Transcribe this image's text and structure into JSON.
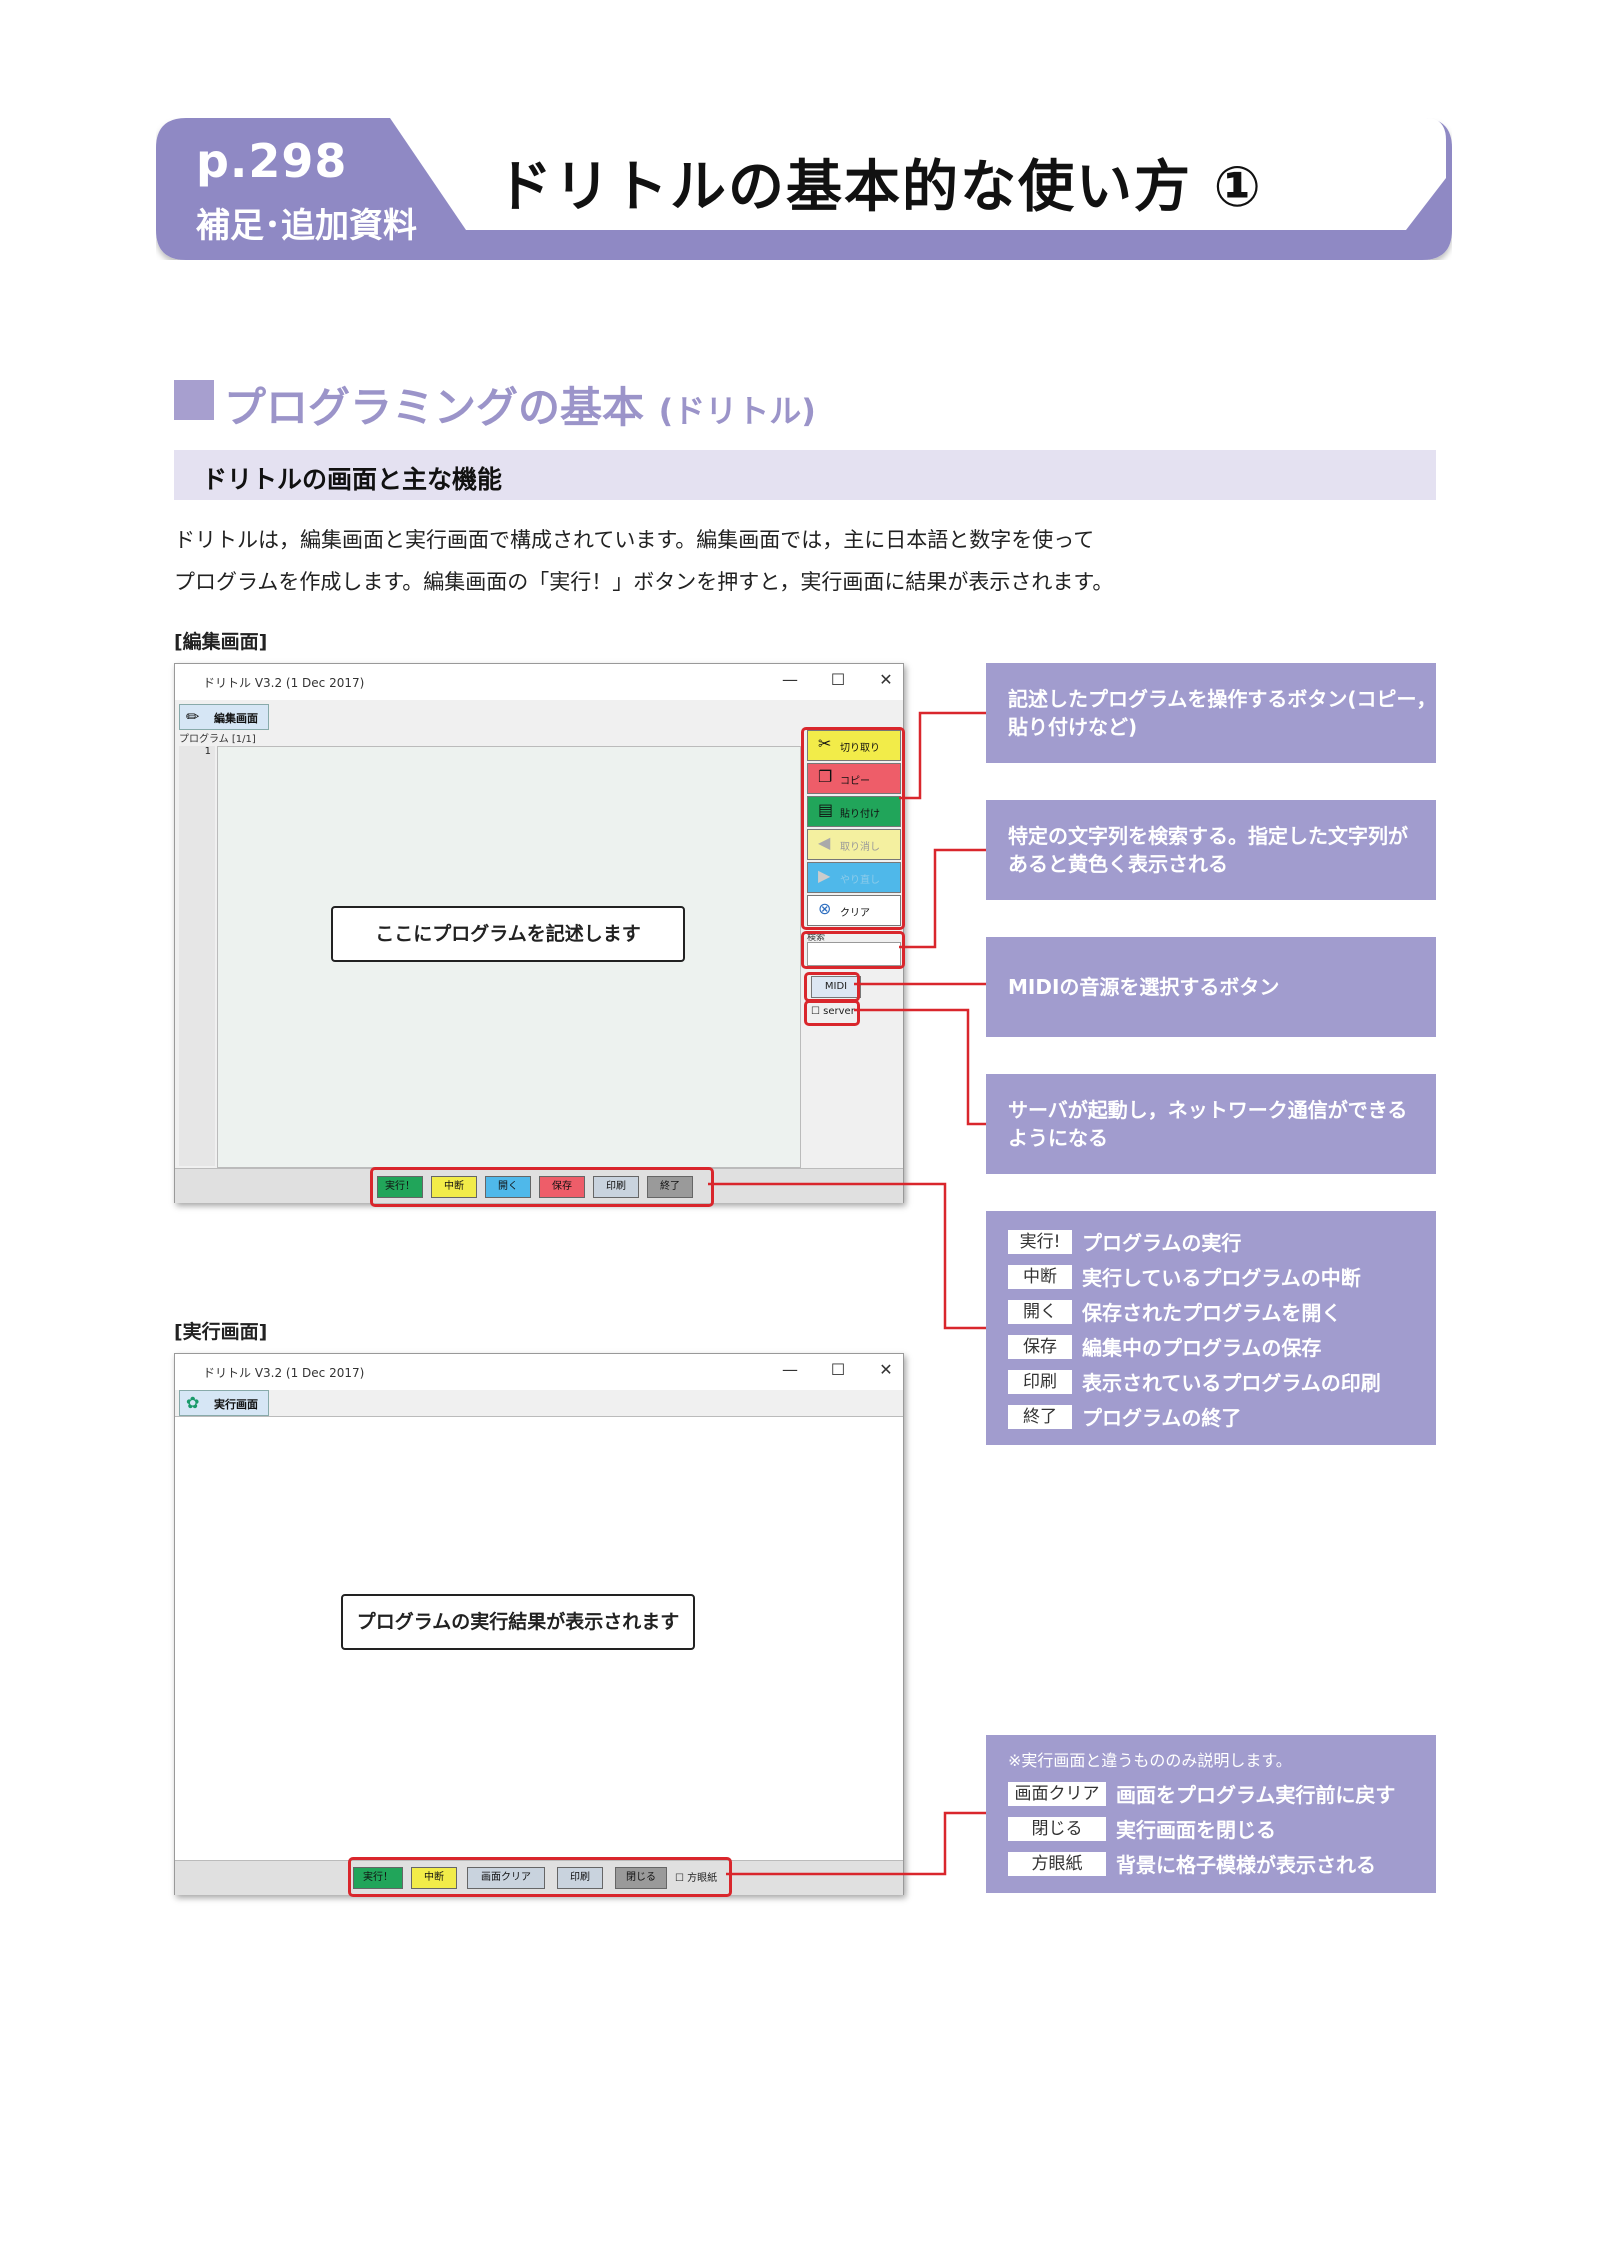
{
  "header": {
    "page": "p.298",
    "sub": "補足･追加資料",
    "title": "ドリトルの基本的な使い方 ①"
  },
  "section": {
    "title": "プログラミングの基本",
    "title_paren": "(ドリトル)",
    "subheading": "ドリトルの画面と主な機能",
    "body": [
      "ドリトルは，編集画面と実行画面で構成されています。編集画面では，主に日本語と数字を使って",
      "プログラムを作成します。編集画面の「実行！」ボタンを押すと，実行画面に結果が表示されます。"
    ]
  },
  "edit_window": {
    "caption": "[編集画面]",
    "title": "ドリトル V3.2 (1 Dec 2017)",
    "tab": "編集画面",
    "program_label": "プログラム [1/1]",
    "line_number": "1",
    "callout": "ここにプログラムを記述します",
    "side_buttons": [
      {
        "label": "切り取り",
        "icon": "scissors-icon"
      },
      {
        "label": "コピー",
        "icon": "copy-icon"
      },
      {
        "label": "貼り付け",
        "icon": "paste-icon"
      },
      {
        "label": "取り消し",
        "icon": "undo-icon"
      },
      {
        "label": "やり直し",
        "icon": "redo-icon"
      },
      {
        "label": "クリア",
        "icon": "clear-icon"
      }
    ],
    "search_label": "検索",
    "midi": "MIDI",
    "server": "server",
    "bottom_buttons": [
      "実行！",
      "中断",
      "開く",
      "保存",
      "印刷",
      "終了"
    ]
  },
  "run_window": {
    "caption": "[実行画面]",
    "title": "ドリトル V3.2 (1 Dec 2017)",
    "tab": "実行画面",
    "callout": "プログラムの実行結果が表示されます",
    "bottom_buttons": [
      "実行！",
      "中断",
      "画面クリア",
      "印刷",
      "閉じる"
    ],
    "grid_checkbox": "方眼紙"
  },
  "info_boxes": {
    "edit_buttons": "記述したプログラムを操作するボタン(コピー，|貼り付けなど)",
    "search": "特定の文字列を検索する。指定した文字列が|あると黄色く表示される",
    "midi": "MIDIの音源を選択するボタン",
    "server": "サーバが起動し，ネットワーク通信ができる|ようになる",
    "bottom": [
      {
        "label": "実行!",
        "desc": "プログラムの実行"
      },
      {
        "label": "中断",
        "desc": "実行しているプログラムの中断"
      },
      {
        "label": "開く",
        "desc": "保存されたプログラムを開く"
      },
      {
        "label": "保存",
        "desc": "編集中のプログラムの保存"
      },
      {
        "label": "印刷",
        "desc": "表示されているプログラムの印刷"
      },
      {
        "label": "終了",
        "desc": "プログラムの終了"
      }
    ],
    "run_note": "※実行画面と違うもののみ説明します。",
    "run": [
      {
        "label": "画面クリア",
        "desc": "画面をプログラム実行前に戻す"
      },
      {
        "label": "閉じる",
        "desc": "実行画面を閉じる"
      },
      {
        "label": "方眼紙",
        "desc": "背景に格子模様が表示される"
      }
    ]
  },
  "colors": {
    "banner": "#8f89c4",
    "accent": "#a19cce",
    "subhead_bg": "#e4e1f1",
    "highlight": "#d9262c"
  }
}
